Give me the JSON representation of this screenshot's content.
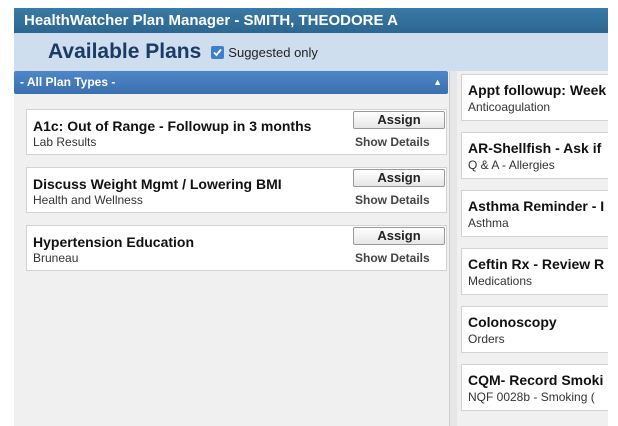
{
  "window": {
    "title": "HealthWatcher Plan Manager - SMITH, THEODORE A"
  },
  "header": {
    "heading": "Available Plans",
    "suggested_only_label": "Suggested only",
    "suggested_only_checked": true
  },
  "filter": {
    "selected": "- All Plan Types -"
  },
  "plans": [
    {
      "name": "A1c: Out of Range - Followup in 3 months",
      "category": "Lab Results",
      "assign_label": "Assign",
      "details_label": "Show Details"
    },
    {
      "name": "Discuss Weight Mgmt / Lowering BMI",
      "category": "Health and Wellness",
      "assign_label": "Assign",
      "details_label": "Show Details"
    },
    {
      "name": "Hypertension Education",
      "category": "Bruneau",
      "assign_label": "Assign",
      "details_label": "Show Details"
    }
  ],
  "right_panel": [
    {
      "name": "Appt followup: Week",
      "category": "Anticoagulation"
    },
    {
      "name": "AR-Shellfish - Ask if",
      "category": "Q & A - Allergies"
    },
    {
      "name": "Asthma Reminder - I",
      "category": "Asthma"
    },
    {
      "name": "Ceftin Rx - Review R",
      "category": "Medications"
    },
    {
      "name": "Colonoscopy",
      "category": "Orders"
    },
    {
      "name": "CQM- Record Smoki",
      "category": "NQF 0028b - Smoking ("
    }
  ],
  "colors": {
    "title_bar": "#2c6690",
    "subheader": "#cfdeee",
    "dropdown": "#3a6fb0",
    "heading": "#1b3b66"
  }
}
